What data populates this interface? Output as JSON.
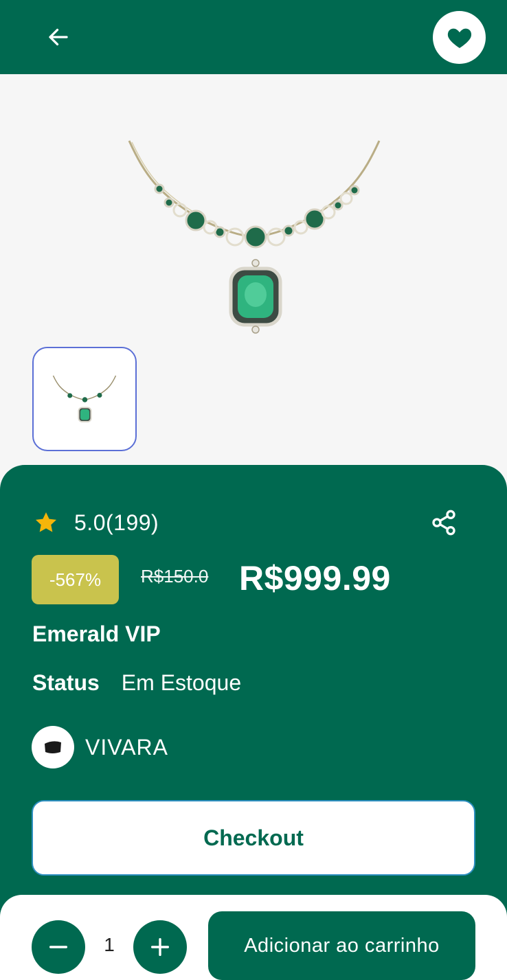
{
  "header": {
    "back_icon": "arrow-left-icon",
    "favorite_icon": "heart-icon"
  },
  "gallery": {
    "main_image": "emerald-necklace",
    "thumbnails": [
      "emerald-necklace"
    ]
  },
  "product": {
    "rating_icon": "star-icon",
    "rating_text": "5.0(199)",
    "share_icon": "share-icon",
    "discount": "-567%",
    "old_price": "R$150.0",
    "price": "R$999.99",
    "name": "Emerald VIP",
    "status_label": "Status",
    "status_value": "Em Estoque",
    "brand_logo": "vivara-logo",
    "brand_name": "VIVARA"
  },
  "actions": {
    "checkout_label": "Checkout",
    "quantity": "1",
    "minus_icon": "minus-icon",
    "plus_icon": "plus-icon",
    "add_to_cart_label": "Adicionar ao carrinho"
  },
  "colors": {
    "primary_green": "#006950",
    "discount_badge": "#c9c34d",
    "star": "#f5b50a",
    "gallery_bg": "#f6f6f6"
  }
}
